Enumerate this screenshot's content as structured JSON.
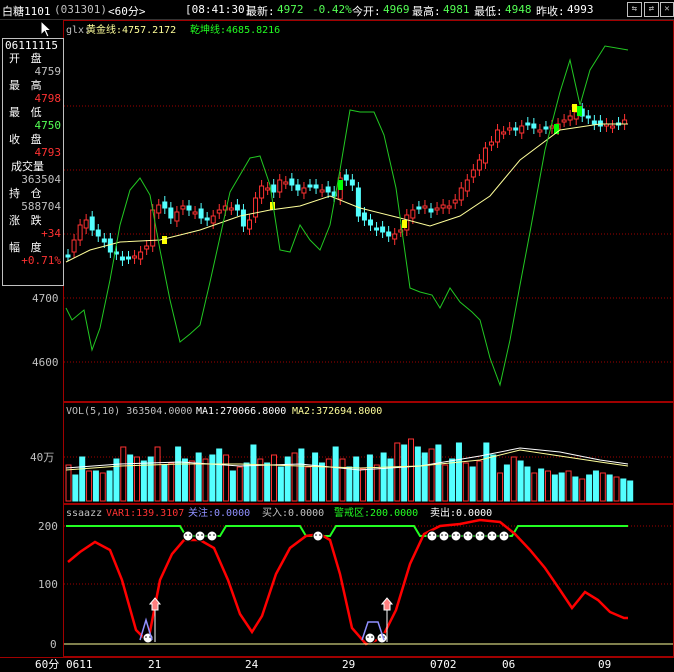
{
  "header": {
    "title": "白糖1101",
    "code": "(031301)",
    "period": "<60分>",
    "time": "[08:41:30]",
    "latest_label": "最新:",
    "latest_value": "4972",
    "change_pct": "-0.42%",
    "open_label": "今开:",
    "open_value": "4969",
    "high_label": "最高:",
    "high_value": "4981",
    "low_label": "最低:",
    "low_value": "4948",
    "prev_close_label": "昨收:",
    "prev_close_value": "4993"
  },
  "main_chart": {
    "indicator_name": "glx:",
    "gold_label": "黄金线:4757.2172",
    "qiankun_label": "乾坤线:4685.8216",
    "y_ticks": [
      "4700",
      "4600"
    ]
  },
  "info_panel": {
    "date": "06111115",
    "open_label": "开 盘",
    "open_value": "4759",
    "high_label": "最 高",
    "high_value": "4798",
    "low_label": "最 低",
    "low_value": "4750",
    "close_label": "收 盘",
    "close_value": "4793",
    "volume_label": "成交量",
    "volume_value": "363504",
    "hold_label": "持 仓",
    "hold_value": "588704",
    "change_label": "涨 跌",
    "change_value": "+34",
    "range_label": "幅 度",
    "range_value": "+0.71%"
  },
  "volume_panel": {
    "label_vol": "VOL(5,10) 363504.0000",
    "label_ma1": "MA1:270066.8000",
    "label_ma2": "MA2:372694.8000",
    "y_tick": "40万"
  },
  "osc_panel": {
    "name": "ssaazz",
    "var1": "VAR1:139.3107",
    "attention": "关注:0.0000",
    "buy": "买入:0.0000",
    "warning": "警戒区:200.0000",
    "sell": "卖出:0.0000",
    "y_ticks": [
      "200",
      "100",
      "0"
    ]
  },
  "x_axis": {
    "period_label": "60分",
    "dates": [
      "0611",
      "21",
      "24",
      "29",
      "0702",
      "06",
      "09"
    ]
  },
  "colors": {
    "up": "#ff3232",
    "down": "#54ffff",
    "gold_line": "#ffff9a",
    "green_line": "#22c822",
    "grid": "#a00000",
    "warning_line": "#22ff22",
    "var1_line": "#ff0000"
  },
  "icons": [
    "window-restore-icon",
    "window-maximize-icon",
    "window-close-icon",
    "mouse-cursor-icon",
    "smiley-icon",
    "house-arrow-icon"
  ]
}
